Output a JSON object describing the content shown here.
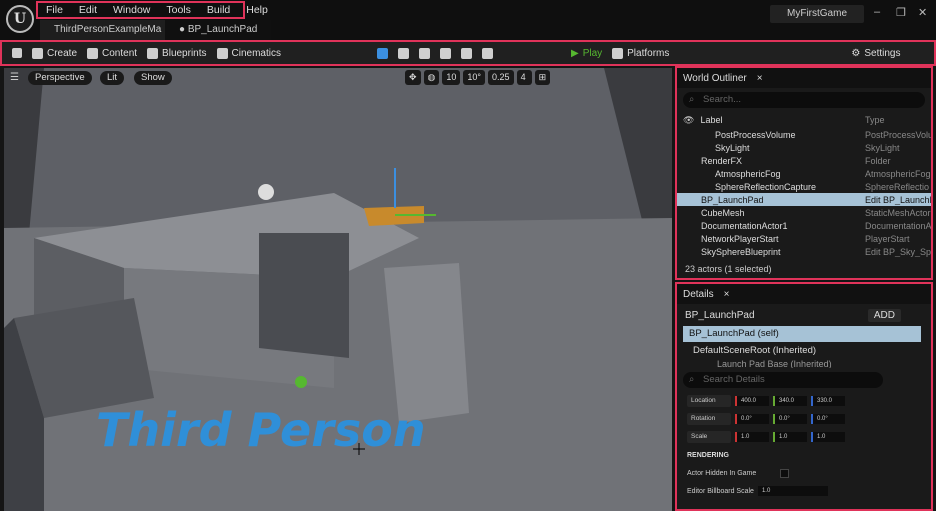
{
  "app": {
    "logo": "U",
    "name": "MyFirstGame"
  },
  "menu": [
    "File",
    "Edit",
    "Window",
    "Tools",
    "Build",
    "Help"
  ],
  "tabs": [
    "ThirdPersonExampleMa",
    "BP_LaunchPad"
  ],
  "toolbar": {
    "create": "Create",
    "content": "Content",
    "blueprints": "Blueprints",
    "cinematics": "Cinematics",
    "play": "Play",
    "platforms": "Platforms",
    "settings": "Settings"
  },
  "viewport": {
    "perspective": "Perspective",
    "lit": "Lit",
    "show": "Show",
    "grid": "10",
    "angle": "10°",
    "scale": "0.25",
    "cams": "4",
    "overlay_text": "Third Person"
  },
  "outliner": {
    "title": "World Outliner",
    "search_placeholder": "Search...",
    "col_label": "Label",
    "col_type": "Type",
    "rows": [
      {
        "label": "PostProcessVolume",
        "type": "PostProcessVolu",
        "indent": 2
      },
      {
        "label": "SkyLight",
        "type": "SkyLight",
        "indent": 2
      },
      {
        "label": "RenderFX",
        "type": "Folder",
        "indent": 1
      },
      {
        "label": "AtmosphericFog",
        "type": "AtmosphericFog",
        "indent": 2
      },
      {
        "label": "SphereReflectionCapture",
        "type": "SphereReflectio",
        "indent": 2
      },
      {
        "label": "BP_LaunchPad",
        "type": "Edit BP_LaunchP",
        "indent": 1,
        "selected": true
      },
      {
        "label": "CubeMesh",
        "type": "StaticMeshActor",
        "indent": 1
      },
      {
        "label": "DocumentationActor1",
        "type": "DocumentationAc",
        "indent": 1
      },
      {
        "label": "NetworkPlayerStart",
        "type": "PlayerStart",
        "indent": 1
      },
      {
        "label": "SkySphereBlueprint",
        "type": "Edit BP_Sky_Sph",
        "indent": 1
      }
    ],
    "status": "23 actors (1 selected)"
  },
  "details": {
    "title": "Details",
    "actor": "BP_LaunchPad",
    "add": "ADD",
    "self": "BP_LaunchPad (self)",
    "root": "DefaultSceneRoot (Inherited)",
    "base": "Launch Pad Base (Inherited)",
    "search_placeholder": "Search Details",
    "location": {
      "label": "Location",
      "x": "400.0",
      "y": "340.0",
      "z": "330.0"
    },
    "rotation": {
      "label": "Rotation",
      "x": "0.0°",
      "y": "0.0°",
      "z": "0.0°"
    },
    "scale": {
      "label": "Scale",
      "x": "1.0",
      "y": "1.0",
      "z": "1.0"
    },
    "rendering": "RENDERING",
    "hidden": "Actor Hidden In Game",
    "billboard": "Editor Billboard Scale",
    "billboard_value": "1.0"
  },
  "colors": {
    "accent": "#e0335a",
    "play": "#56b830",
    "text3d": "#2f8fd8"
  }
}
